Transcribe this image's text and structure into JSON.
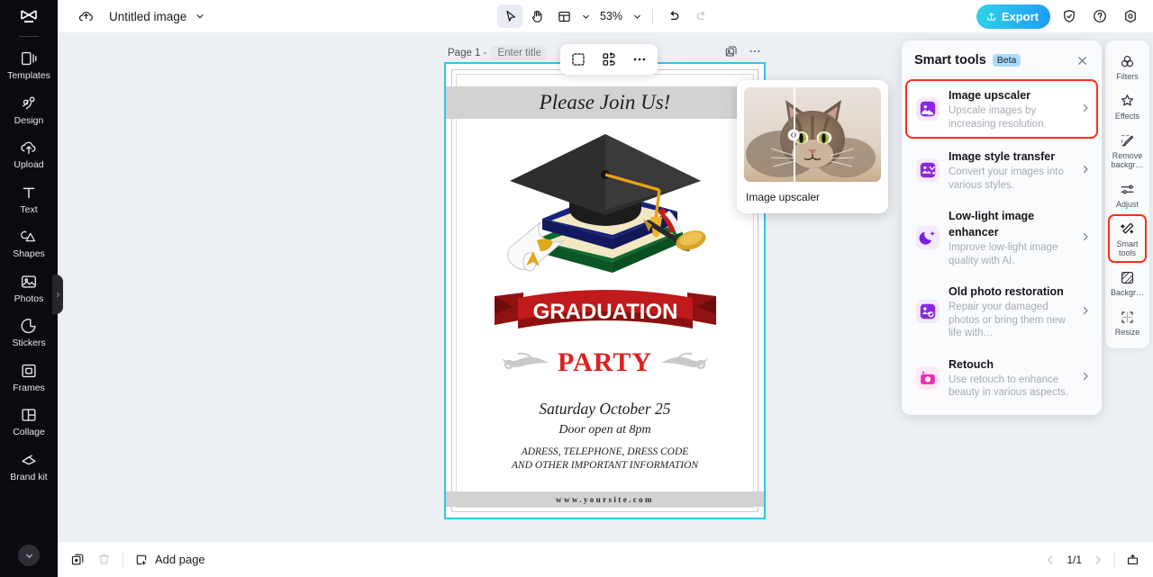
{
  "app": {
    "brand_icon": "capcut-logo-icon",
    "accent_cyan": "#2fc6e8",
    "accent_blue": "#1f9bf5",
    "highlight_red": "#ff2d16"
  },
  "topbar": {
    "cloud_icon": "cloud-save-icon",
    "document_title": "Untitled image",
    "title_caret_icon": "chevron-down-icon",
    "tools": [
      {
        "name": "select-tool",
        "icon": "cursor-arrow-icon",
        "active": true
      },
      {
        "name": "hand-tool",
        "icon": "hand-icon",
        "active": false
      },
      {
        "name": "layout-tool",
        "icon": "layout-grid-icon",
        "active": false
      }
    ],
    "layout_caret_icon": "chevron-down-icon",
    "zoom_level": "53%",
    "zoom_caret_icon": "chevron-down-icon",
    "undo_icon": "undo-arrow-icon",
    "redo_icon": "redo-arrow-icon",
    "export_label": "Export",
    "export_icon": "upload-icon",
    "shield_icon": "shield-check-icon",
    "help_icon": "question-circle-icon",
    "settings_icon": "gear-icon"
  },
  "left_rail": {
    "items": [
      {
        "label": "Templates",
        "icon": "templates-icon"
      },
      {
        "label": "Design",
        "icon": "design-icon"
      },
      {
        "label": "Upload",
        "icon": "upload-cloud-icon"
      },
      {
        "label": "Text",
        "icon": "text-t-icon"
      },
      {
        "label": "Shapes",
        "icon": "shapes-icon"
      },
      {
        "label": "Photos",
        "icon": "photos-image-icon"
      },
      {
        "label": "Stickers",
        "icon": "sticker-icon"
      },
      {
        "label": "Frames",
        "icon": "frames-icon"
      },
      {
        "label": "Collage",
        "icon": "collage-icon"
      },
      {
        "label": "Brand kit",
        "icon": "brand-kit-icon"
      }
    ],
    "collapse_icon": "chevron-down-circle-icon",
    "handle_icon": "chevron-right-icon"
  },
  "canvas": {
    "page_label": "Page 1 -",
    "page_title_placeholder": "Enter title",
    "duplicate_page_icon": "duplicate-page-icon",
    "page_more_icon": "more-horizontal-icon",
    "object_toolbar": [
      {
        "name": "cutout-subject-button",
        "icon": "cutout-select-icon"
      },
      {
        "name": "replace-image-button",
        "icon": "replace-swap-icon"
      },
      {
        "name": "more-options-button",
        "icon": "more-horizontal-icon"
      }
    ]
  },
  "poster": {
    "header": "Please Join Us!",
    "banner_title": "GRADUATION",
    "party": "PARTY",
    "date": "Saturday October 25",
    "door": "Door open at 8pm",
    "info_line1": "ADRESS, TELEPHONE, DRESS CODE",
    "info_line2": "AND OTHER IMPORTANT INFORMATION",
    "website": "www.yoursite.com"
  },
  "preview_card": {
    "label": "Image upscaler",
    "image_alt": "tabby-cat-before-after-preview",
    "slider_icon": "before-after-slider-handle-icon"
  },
  "smart_tools_panel": {
    "title": "Smart tools",
    "badge": "Beta",
    "close_icon": "close-x-icon",
    "arrow_icon": "chevron-right-icon",
    "tools": [
      {
        "name": "Image upscaler",
        "description": "Upscale images by increasing resolution.",
        "icon": "image-upscaler-4k-icon",
        "icon_color": "#8b27e0",
        "highlighted": true
      },
      {
        "name": "Image style transfer",
        "description": "Convert your images into various styles.",
        "icon": "image-style-transfer-icon",
        "icon_color": "#8b27e0",
        "highlighted": false
      },
      {
        "name": "Low-light image enhancer",
        "description": "Improve low-light image quality with AI.",
        "icon": "moon-sparkle-icon",
        "icon_color": "#7b1fe0",
        "highlighted": false
      },
      {
        "name": "Old photo restoration",
        "description": "Repair your damaged photos or bring them new life with…",
        "icon": "old-photo-restore-icon",
        "icon_color": "#8b27e0",
        "highlighted": false
      },
      {
        "name": "Retouch",
        "description": "Use retouch to enhance beauty in various aspects.",
        "icon": "retouch-sparkle-icon",
        "icon_color": "#ea2fb4",
        "highlighted": false
      }
    ]
  },
  "right_rail": {
    "items": [
      {
        "label": "Filters",
        "icon": "filters-circles-icon",
        "selected": false
      },
      {
        "label": "Effects",
        "icon": "effects-star-icon",
        "selected": false
      },
      {
        "label": "Remove backgr…",
        "icon": "remove-background-icon",
        "selected": false
      },
      {
        "label": "Adjust",
        "icon": "adjust-sliders-icon",
        "selected": false
      },
      {
        "label": "Smart tools",
        "icon": "smart-tools-wand-icon",
        "selected": true
      },
      {
        "label": "Backgr…",
        "icon": "background-icon",
        "selected": false
      },
      {
        "label": "Resize",
        "icon": "resize-icon",
        "selected": false
      }
    ]
  },
  "bottombar": {
    "duplicate_icon": "duplicate-icon",
    "delete_icon": "trash-icon",
    "add_page_label": "Add page",
    "add_page_icon": "add-page-plus-icon",
    "prev_icon": "chevron-left-icon",
    "next_icon": "chevron-right-icon",
    "page_indicator": "1/1",
    "present_icon": "present-slideshow-icon"
  }
}
